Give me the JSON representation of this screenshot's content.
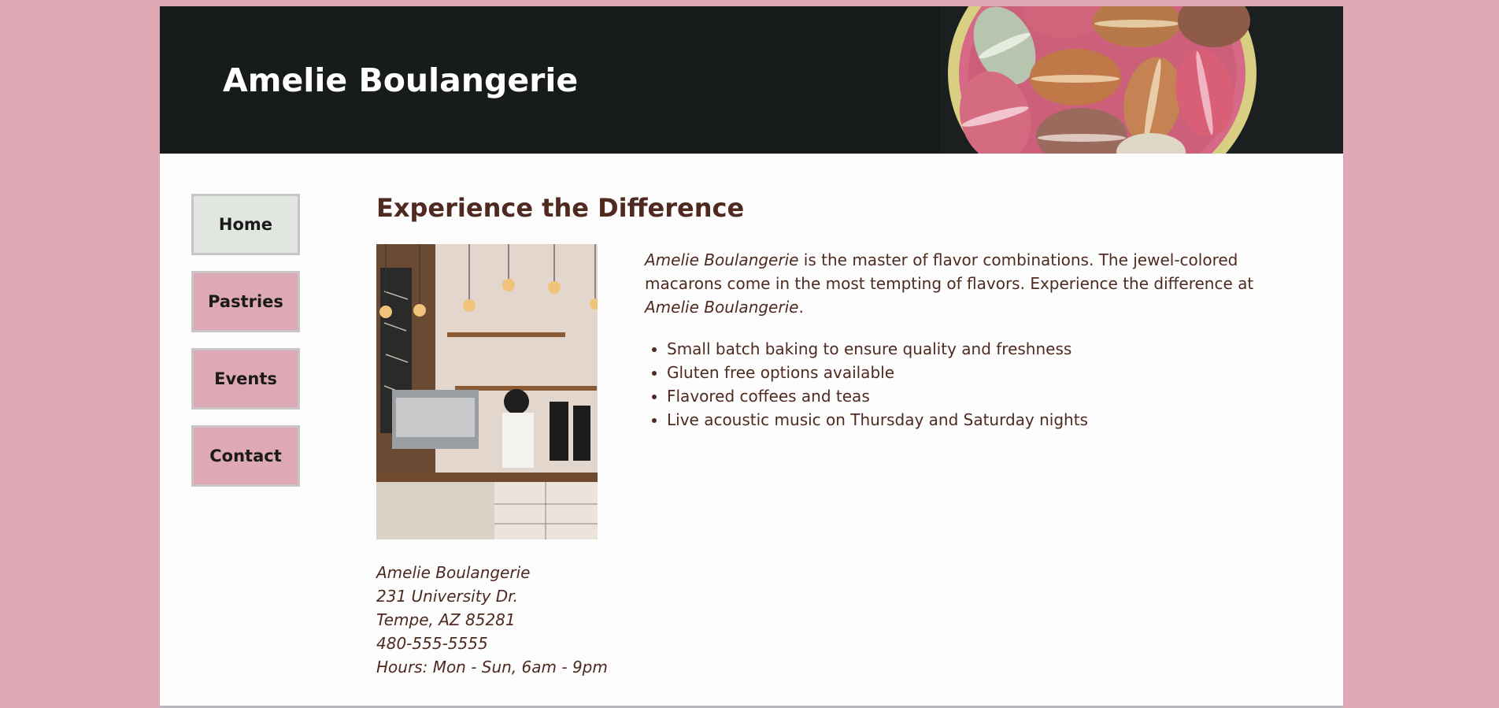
{
  "header": {
    "title": "Amelie Boulangerie"
  },
  "nav": {
    "items": [
      {
        "label": "Home",
        "active": true
      },
      {
        "label": "Pastries",
        "active": false
      },
      {
        "label": "Events",
        "active": false
      },
      {
        "label": "Contact",
        "active": false
      }
    ]
  },
  "main": {
    "heading": "Experience the Difference",
    "intro": {
      "brand_start": "Amelie Boulangerie",
      "text": " is the master of flavor combinations. The jewel-colored macarons come in the most tempting of flavors. Experience the difference at ",
      "brand_end": "Amelie Boulangerie",
      "period": "."
    },
    "features": [
      "Small batch baking to ensure quality and freshness",
      "Gluten free options available",
      "Flavored coffees and teas",
      "Live acoustic music on Thursday and Saturday nights"
    ],
    "address": {
      "name": "Amelie Boulangerie",
      "street": "231 University Dr.",
      "city": "Tempe, AZ 85281",
      "phone": "480-555-5555",
      "hours": "Hours: Mon - Sun, 6am - 9pm"
    }
  },
  "colors": {
    "background": "#dea9b5",
    "header_bg": "#171b1c",
    "text_brown": "#4e2a20",
    "nav_active": "#e2e6e1"
  }
}
